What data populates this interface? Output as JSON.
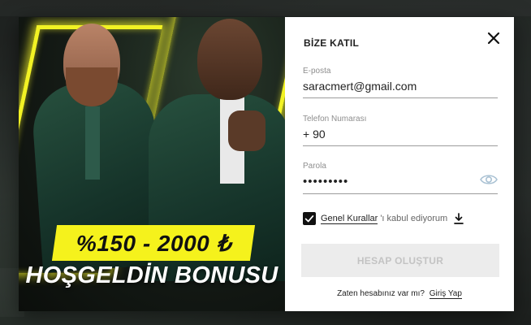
{
  "promo": {
    "bonus_text": "%150 - 2000 ₺",
    "welcome_text": "HOŞGELDİN BONUSU",
    "accent_color": "#f5f21c"
  },
  "form": {
    "title": "BİZE KATIL",
    "email": {
      "label": "E-posta",
      "value": "saracmert@gmail.com"
    },
    "phone": {
      "label": "Telefon Numarası",
      "value": "+ 90"
    },
    "password": {
      "label": "Parola",
      "value": "•••••••••"
    },
    "terms": {
      "checked": true,
      "link_label": "Genel Kurallar",
      "rest_label": "'ı kabul ediyorum"
    },
    "submit_label": "HESAP OLUŞTUR",
    "login_prompt": "Zaten hesabınız var mı?",
    "login_link": "Giriş Yap"
  },
  "icons": {
    "close": "close-icon",
    "eye": "eye-icon",
    "checkbox": "checkmark-icon",
    "download": "download-icon"
  }
}
